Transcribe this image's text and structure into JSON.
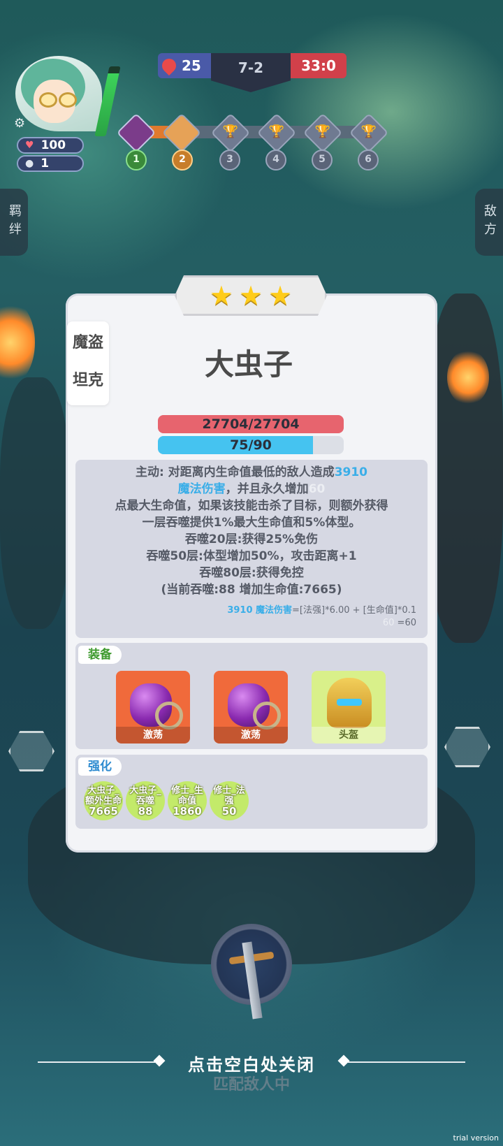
{
  "hud": {
    "player_hp": "100",
    "player_coins": "1",
    "score_left": "25",
    "round": "7-2",
    "score_right": "33:0",
    "stages": [
      "1",
      "2",
      "3",
      "4",
      "5",
      "6"
    ],
    "side_left": "羁绊",
    "side_right": "敌方"
  },
  "unit": {
    "stars": [
      "★",
      "★",
      "★"
    ],
    "traits": [
      "魔盗",
      "坦克"
    ],
    "name": "大虫子",
    "hp_text": "27704/27704",
    "hp_fraction": 1.0,
    "mana_text": "75/90",
    "mana_fraction": 0.8333
  },
  "skill": {
    "line1_a": "主动: 对距离内生命值最低的敌人造成",
    "line1_val": "3910",
    "line2_a": "魔法伤害",
    "line2_b": "，并且永久增加",
    "line2_val": "60",
    "line3": "点最大生命值，如果该技能击杀了目标，则额外获得",
    "line4": "一层吞噬提供1%最大生命值和5%体型。",
    "line5": "吞噬20层:获得25%免伤",
    "line6": "吞噬50层:体型增加50%，攻击距离+1",
    "line7": "吞噬80层:获得免控",
    "line8": "(当前吞噬:88 增加生命值:7665)",
    "formula1_a": "3910 魔法伤害",
    "formula1_b": "=[法强]*6.00 + [生命值]*0.1",
    "formula2_a": "60",
    "formula2_b": " =60"
  },
  "equipment": {
    "label": "装备",
    "items": [
      {
        "name": "激荡",
        "icon": "purple-gem-icon"
      },
      {
        "name": "激荡",
        "icon": "purple-gem-icon"
      },
      {
        "name": "头盔",
        "icon": "golden-helmet-icon"
      }
    ]
  },
  "enhance": {
    "label": "强化",
    "items": [
      {
        "name_1": "大虫子_",
        "name_2": "额外生命",
        "value": "7665"
      },
      {
        "name_1": "大虫子_",
        "name_2": "吞噬",
        "value": "88"
      },
      {
        "name_1": "修士_生",
        "name_2": "命值",
        "value": "1860"
      },
      {
        "name_1": "修士_法",
        "name_2": "强",
        "value": "50"
      }
    ]
  },
  "footer": {
    "close_hint": "点击空白处关闭",
    "matching": "匹配敌人中",
    "watermark": "trial version"
  },
  "colors": {
    "hp": "#e7646e",
    "mana": "#45c3f0",
    "panel": "#f3f4f7"
  }
}
